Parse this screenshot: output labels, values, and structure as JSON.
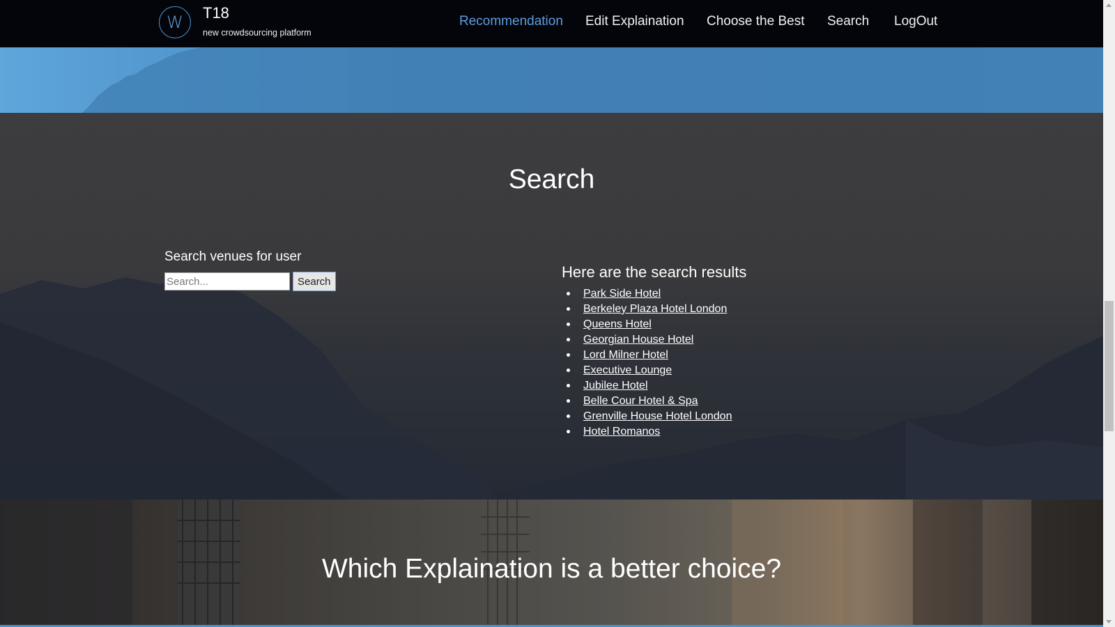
{
  "brand": {
    "logo_letter": "W",
    "title": "T18",
    "subtitle": "new crowdsourcing platform"
  },
  "nav": {
    "items": [
      {
        "label": "Recommendation",
        "active": true
      },
      {
        "label": "Edit Explaination",
        "active": false
      },
      {
        "label": "Choose the Best",
        "active": false
      },
      {
        "label": "Search",
        "active": false
      },
      {
        "label": "LogOut",
        "active": false
      }
    ],
    "active_color": "#5d9de0"
  },
  "search_section": {
    "title": "Search",
    "form_label": "Search venues for user",
    "input_value": "",
    "input_placeholder": "Search...",
    "button_label": "Search",
    "results_title": "Here are the search results",
    "results": [
      "Park Side Hotel",
      "Berkeley Plaza Hotel London",
      "Queens Hotel",
      "Georgian House Hotel",
      "Lord Milner Hotel",
      "Executive Lounge",
      "Jubilee Hotel",
      "Belle Cour Hotel & Spa",
      "Grenville House Hotel London",
      "Hotel Romanos"
    ]
  },
  "choice_section": {
    "title": "Which Explaination is a better choice?"
  }
}
